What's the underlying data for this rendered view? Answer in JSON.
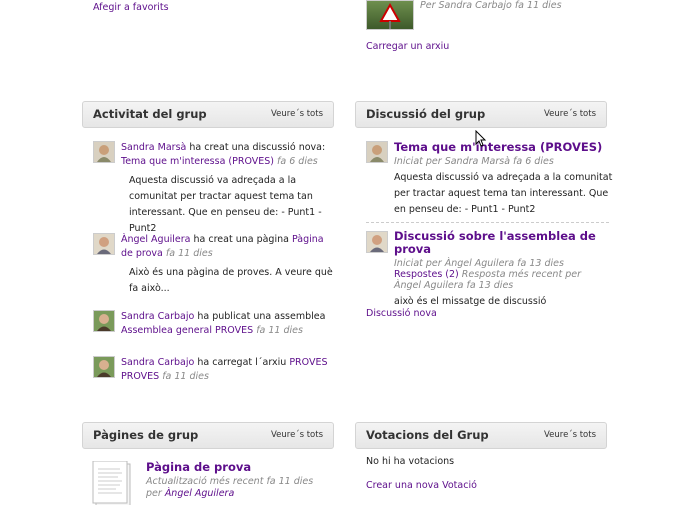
{
  "top": {
    "favorite_link": "Afegir a favorits",
    "file_byline": "Per Sandra Carbajo fa 11 dies",
    "upload_link": "Carregar un arxiu"
  },
  "activity": {
    "title": "Activitat del grup",
    "view_all": "Veure´s tots",
    "items": [
      {
        "actor": "Sandra Marsà",
        "action": "ha creat una discussió nova:",
        "target": "Tema que m'interessa (PROVES)",
        "time": "fa 6 dies",
        "excerpt": "Aquesta discussió va adreçada a la comunitat per tractar aquest tema tan interessant. Que en penseu de: - Punt1 - Punt2"
      },
      {
        "actor": "Àngel Aguilera",
        "action": "ha creat una pàgina",
        "target": "Pàgina de prova",
        "time": "fa 11 dies",
        "excerpt": "Això és una pàgina de proves. A veure què fa això..."
      },
      {
        "actor": "Sandra Carbajo",
        "action": "ha publicat una assemblea",
        "target": "Assemblea general PROVES",
        "time": "fa 11 dies"
      },
      {
        "actor": "Sandra Carbajo",
        "action": "ha carregat l´arxiu",
        "target": "PROVES PROVES",
        "time": "fa 11 dies"
      }
    ]
  },
  "discussion": {
    "title": "Discussió del grup",
    "view_all": "Veure´s tots",
    "items": [
      {
        "title": "Tema que m'interessa (PROVES)",
        "meta": "Iniciat per Sandra Marsà fa 6 dies",
        "body": "Aquesta discussió va adreçada a la comunitat per tractar aquest tema tan interessant. Que en penseu de: - Punt1 - Punt2"
      },
      {
        "title": "Discussió sobre l'assemblea de prova",
        "meta_prefix": "Iniciat per Àngel Aguilera fa 13 dies",
        "replies": "Respostes (2)",
        "meta_suffix": "Resposta més recent per Àngel Aguilera fa 13 dies",
        "body": "això és el missatge de discussió"
      }
    ],
    "new_link": "Discussió nova"
  },
  "pages": {
    "title": "Pàgines de grup",
    "view_all": "Veure´s tots",
    "item_title": "Pàgina de prova",
    "item_meta": "Actualització més recent fa 11 dies per",
    "item_author": "Àngel Aguilera"
  },
  "votes": {
    "title": "Votacions del Grup",
    "view_all": "Veure´s tots",
    "empty": "No hi ha votacions",
    "create_link": "Crear una nova Votació"
  }
}
